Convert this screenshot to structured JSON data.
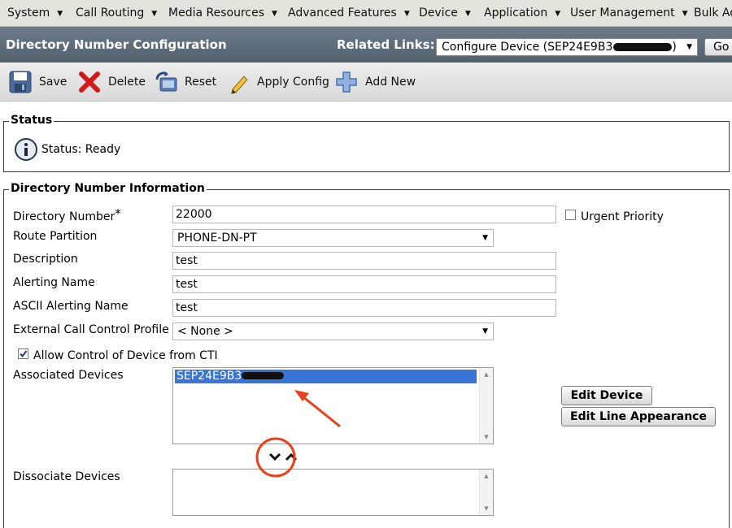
{
  "menu": [
    {
      "label": "System"
    },
    {
      "label": "Call Routing"
    },
    {
      "label": "Media Resources"
    },
    {
      "label": "Advanced Features"
    },
    {
      "label": "Device"
    },
    {
      "label": "Application"
    },
    {
      "label": "User Management"
    },
    {
      "label": "Bulk Ad"
    }
  ],
  "header": {
    "title": "Directory Number Configuration",
    "related_links_label": "Related Links:",
    "related_links_value": "Configure Device (SEP24E9B3",
    "go_label": "Go"
  },
  "toolbar": {
    "save": "Save",
    "delete": "Delete",
    "reset": "Reset",
    "apply_config": "Apply Config",
    "add_new": "Add New"
  },
  "status": {
    "legend": "Status",
    "text": "Status: Ready"
  },
  "dn_info": {
    "legend": "Directory Number Information",
    "directory_number_label": "Directory Number",
    "required_mark": "*",
    "directory_number_value": "22000",
    "urgent_priority_label": "Urgent Priority",
    "urgent_priority_checked": false,
    "route_partition_label": "Route Partition",
    "route_partition_value": "PHONE-DN-PT",
    "description_label": "Description",
    "description_value": "test",
    "alerting_name_label": "Alerting Name",
    "alerting_name_value": "test",
    "ascii_alerting_name_label": "ASCII Alerting Name",
    "ascii_alerting_name_value": "test",
    "external_call_control_label": "External Call Control Profile",
    "external_call_control_value": "< None >",
    "allow_cti_label": "Allow Control of Device from CTI",
    "allow_cti_checked": true,
    "associated_devices_label": "Associated Devices",
    "associated_devices": [
      "SEP24E9B3"
    ],
    "edit_device_label": "Edit Device",
    "edit_line_appearance_label": "Edit Line Appearance",
    "dissociate_devices_label": "Dissociate Devices"
  },
  "colors": {
    "title_bar": "#5e6c78",
    "menu_bar": "#e4e4df",
    "selection": "#3875d7",
    "annotation": "#e8401c"
  }
}
